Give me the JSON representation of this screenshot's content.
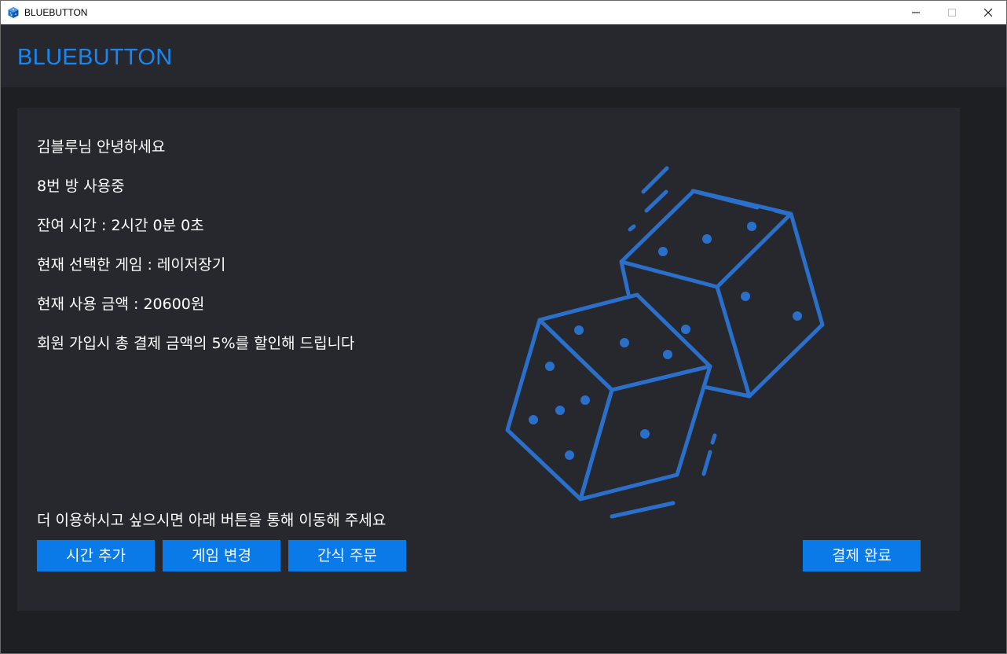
{
  "window": {
    "title": "BLUEBUTTON",
    "icon": "app-cube-icon",
    "controls": [
      "minimize-icon",
      "maximize-icon",
      "close-icon"
    ]
  },
  "header": {
    "brand": "BLUEBUTTON"
  },
  "info": {
    "greeting": "김블루님 안녕하세요",
    "room": "8번 방 사용중",
    "remaining_time": "잔여 시간 : 2시간 0분 0초",
    "selected_game": "현재 선택한 게임 : 레이저장기",
    "current_amount": "현재 사용 금액 : 20600원",
    "promo": "회원 가입시 총 결제 금액의 5%를 할인해 드립니다"
  },
  "prompt": "더 이용하시고 싶으시면 아래 버튼을 통해 이동해 주세요",
  "buttons": {
    "add_time": "시간 추가",
    "change_game": "게임 변경",
    "snack_order": "간식 주문",
    "checkout": "결제 완료"
  },
  "illustration": "dice-icon",
  "colors": {
    "accent": "#1b86f0",
    "button": "#0a7ae8",
    "dice": "#2a6fc9",
    "card_bg": "#27282e",
    "page_bg": "#1e1f22"
  }
}
